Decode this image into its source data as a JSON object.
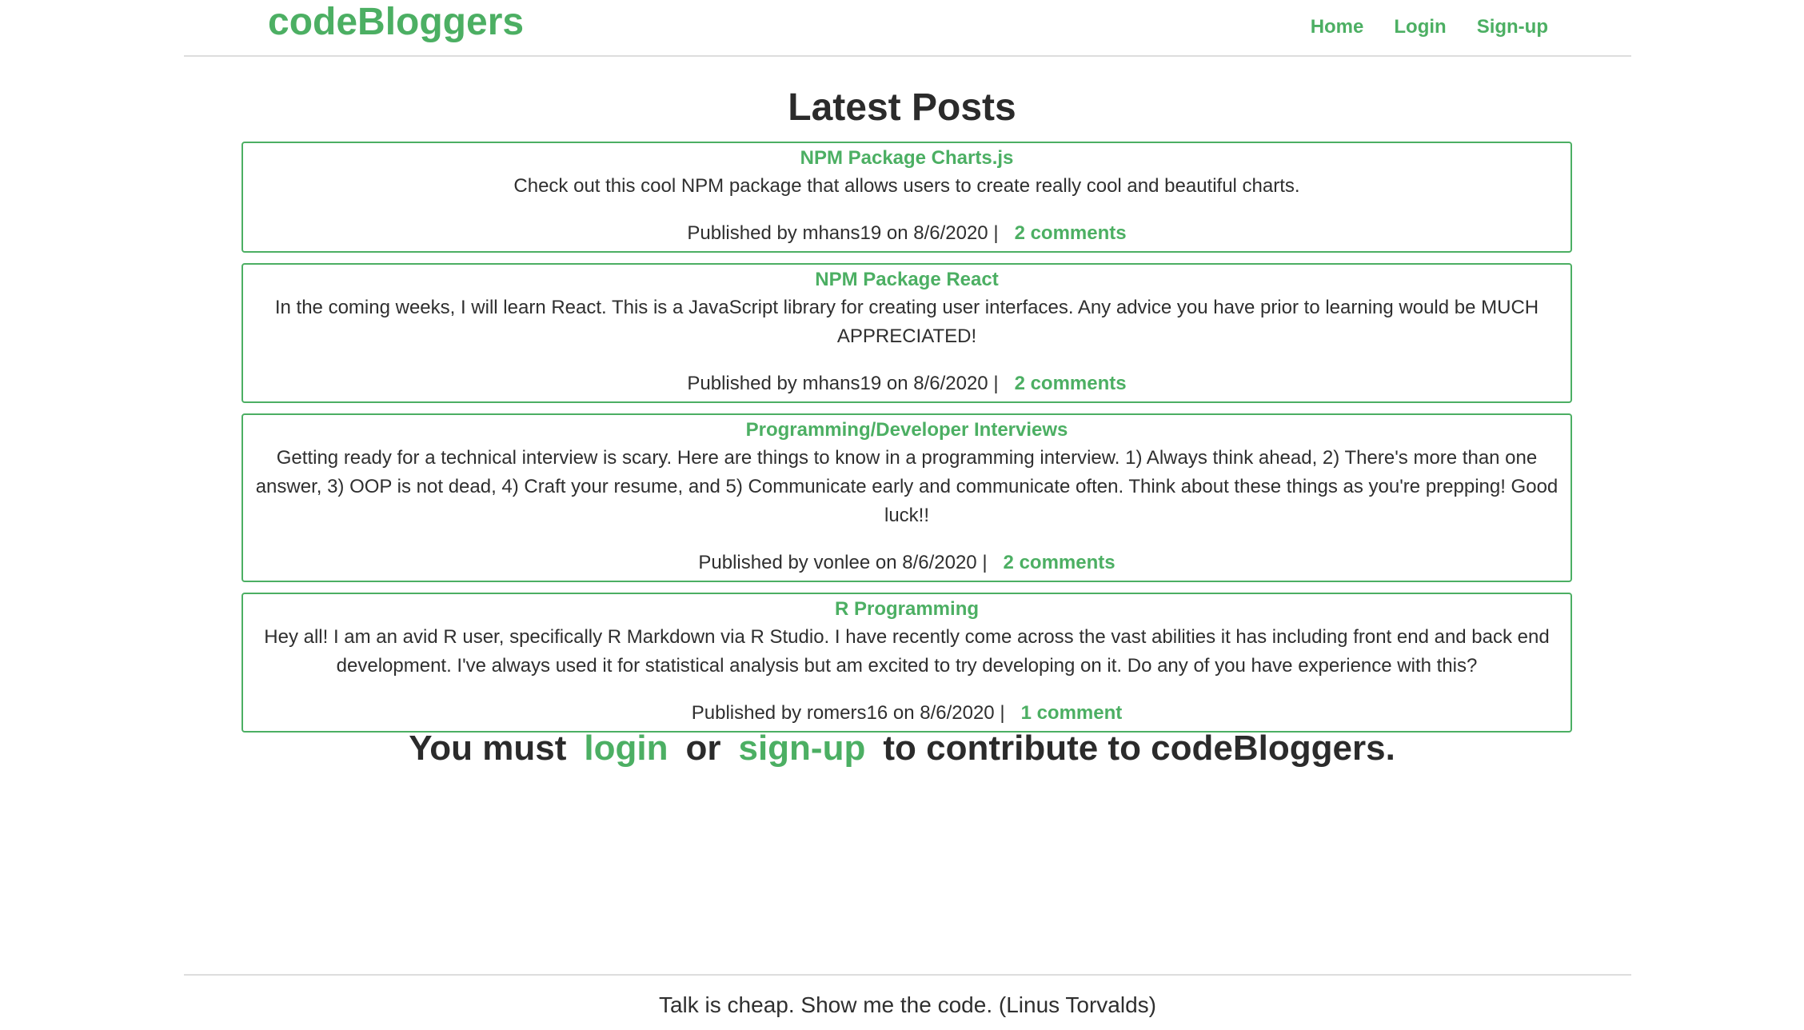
{
  "header": {
    "brand": "codeBloggers",
    "nav": [
      {
        "label": "Home"
      },
      {
        "label": "Login"
      },
      {
        "label": "Sign-up"
      }
    ]
  },
  "main": {
    "title": "Latest Posts",
    "posts": [
      {
        "title": "NPM Package Charts.js",
        "body": "Check out this cool NPM package that allows users to create really cool and beautiful charts.",
        "meta": "Published by mhans19 on 8/6/2020 |",
        "comments": "2 comments"
      },
      {
        "title": "NPM Package React",
        "body": "In the coming weeks, I will learn React. This is a JavaScript library for creating user interfaces. Any advice you have prior to learning would be MUCH APPRECIATED!",
        "meta": "Published by mhans19 on 8/6/2020 |",
        "comments": "2 comments"
      },
      {
        "title": "Programming/Developer Interviews",
        "body": "Getting ready for a technical interview is scary. Here are things to know in a programming interview. 1) Always think ahead, 2) There's more than one answer, 3) OOP is not dead, 4) Craft your resume, and 5) Communicate early and communicate often. Think about these things as you're prepping! Good luck!!",
        "meta": "Published by vonlee on 8/6/2020 |",
        "comments": "2 comments"
      },
      {
        "title": "R Programming",
        "body": "Hey all! I am an avid R user, specifically R Markdown via R Studio. I have recently come across the vast abilities it has including front end and back end development. I've always used it for statistical analysis but am excited to try developing on it. Do any of you have experience with this?",
        "meta": "Published by romers16 on 8/6/2020 |",
        "comments": "1 comment"
      }
    ],
    "contribute": {
      "prefix": "You must",
      "login_label": "login",
      "or": "or",
      "signup_label": "sign-up",
      "suffix": "to contribute to codeBloggers."
    }
  },
  "footer": {
    "quote": "Talk is cheap. Show me the code. (Linus Torvalds)"
  },
  "colors": {
    "accent": "#4caf63",
    "text": "#2f2f2f",
    "divider": "#dddddd"
  }
}
